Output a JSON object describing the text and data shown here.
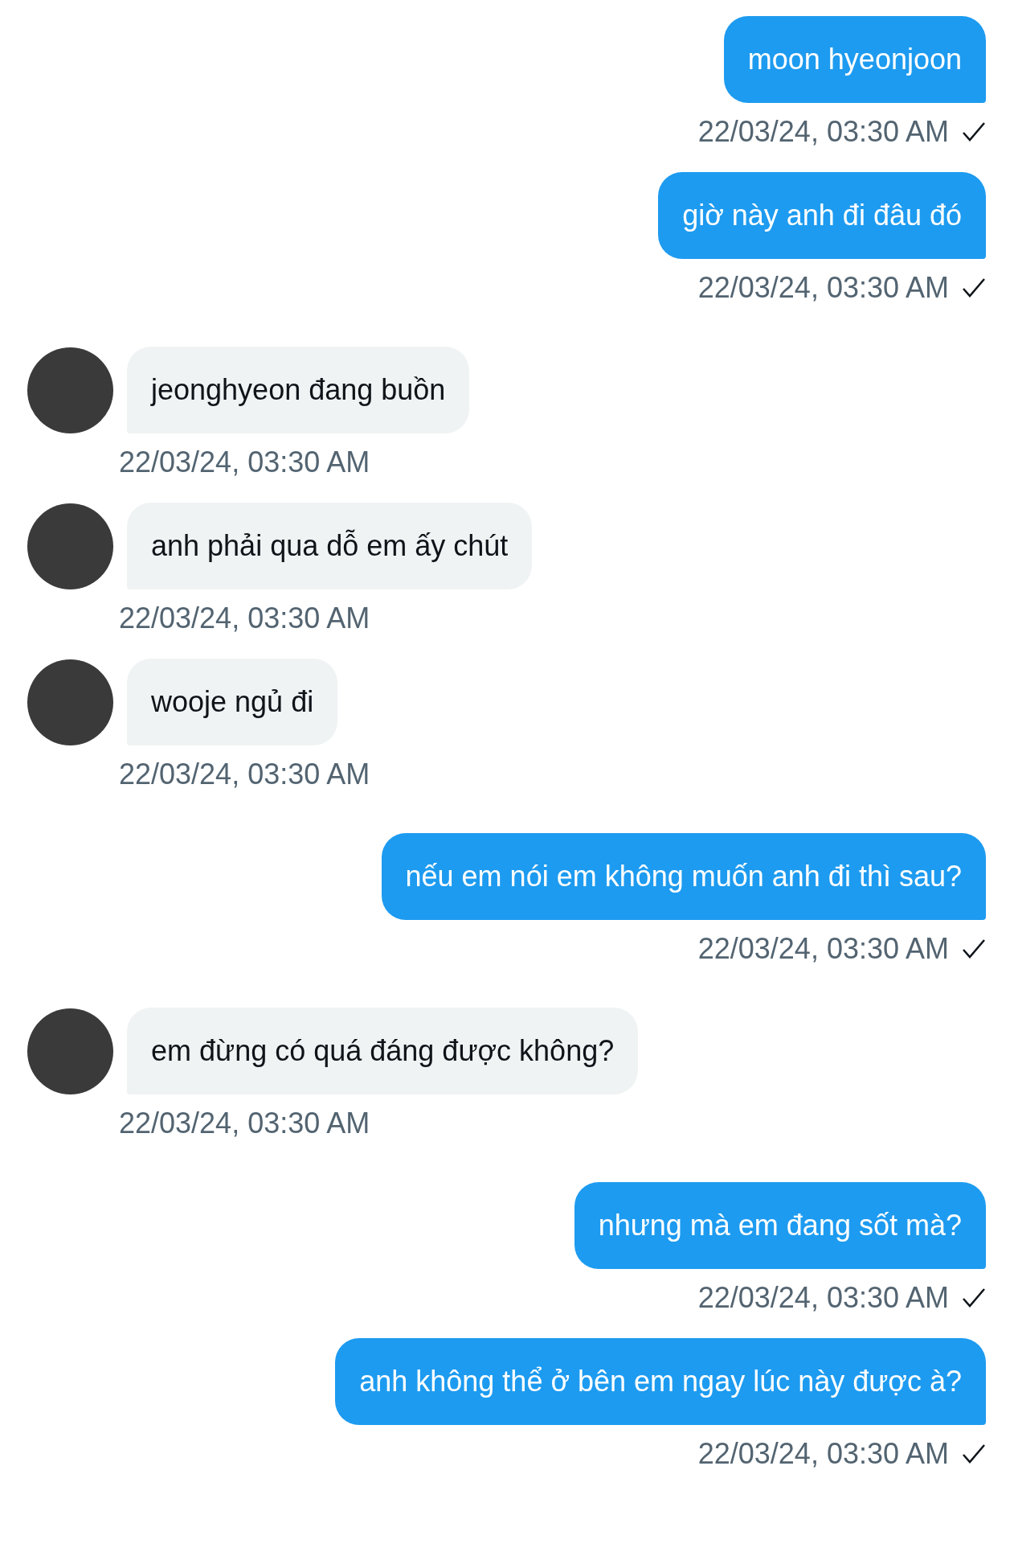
{
  "messages": [
    {
      "kind": "sent",
      "text": "moon hyeonjoon",
      "time": "22/03/24, 03:30 AM",
      "delivered": true
    },
    {
      "kind": "sent",
      "text": "giờ này anh đi đâu đó",
      "time": "22/03/24, 03:30 AM",
      "delivered": true
    },
    {
      "kind": "received",
      "text": "jeonghyeon đang buồn",
      "time": "22/03/24, 03:30 AM"
    },
    {
      "kind": "received",
      "text": "anh phải qua dỗ em ấy chút",
      "time": "22/03/24, 03:30 AM"
    },
    {
      "kind": "received",
      "text": "wooje ngủ đi",
      "time": "22/03/24, 03:30 AM"
    },
    {
      "kind": "sent",
      "text": "nếu em nói em không muốn anh đi thì sau?",
      "time": "22/03/24, 03:30 AM",
      "delivered": true
    },
    {
      "kind": "received",
      "text": "em đừng có quá đáng được không?",
      "time": "22/03/24, 03:30 AM"
    },
    {
      "kind": "sent",
      "text": "nhưng mà em đang sốt mà?",
      "time": "22/03/24, 03:30 AM",
      "delivered": true
    },
    {
      "kind": "sent",
      "text": "anh không thể ở bên em ngay lúc này được à?",
      "time": "22/03/24, 03:30 AM",
      "delivered": true
    }
  ]
}
